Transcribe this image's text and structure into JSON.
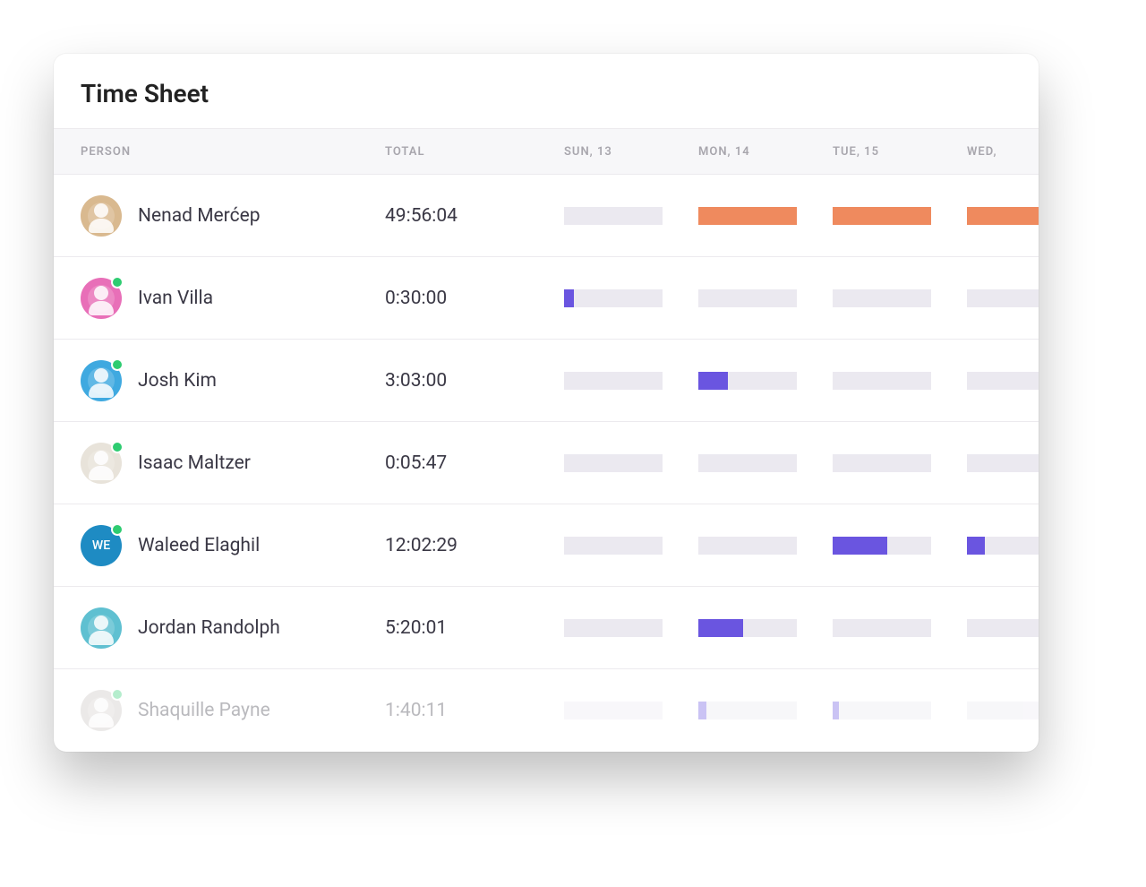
{
  "title": "Time Sheet",
  "columns": {
    "person": "PERSON",
    "total": "TOTAL",
    "days": [
      "SUN, 13",
      "MON, 14",
      "TUE, 15",
      "WED,"
    ]
  },
  "colors": {
    "bar_track": "#ebe9f0",
    "bar_purple": "#6a55e0",
    "bar_orange": "#ef8a5e",
    "status_online": "#2ecc71"
  },
  "people": [
    {
      "name": "Nenad Merćep",
      "total": "49:56:04",
      "online": false,
      "avatar": {
        "type": "photo",
        "bg": "#d9b98f"
      },
      "bars": [
        {
          "fill": 0,
          "color": "purple"
        },
        {
          "fill": 100,
          "color": "orange"
        },
        {
          "fill": 100,
          "color": "orange"
        },
        {
          "fill": 100,
          "color": "orange"
        }
      ]
    },
    {
      "name": "Ivan Villa",
      "total": "0:30:00",
      "online": true,
      "avatar": {
        "type": "photo",
        "bg": "#e86fb8"
      },
      "bars": [
        {
          "fill": 10,
          "color": "purple"
        },
        {
          "fill": 0,
          "color": "purple"
        },
        {
          "fill": 0,
          "color": "purple"
        },
        {
          "fill": 0,
          "color": "purple"
        }
      ]
    },
    {
      "name": "Josh Kim",
      "total": "3:03:00",
      "online": true,
      "avatar": {
        "type": "photo",
        "bg": "#3fa9e0"
      },
      "bars": [
        {
          "fill": 0,
          "color": "purple"
        },
        {
          "fill": 30,
          "color": "purple"
        },
        {
          "fill": 0,
          "color": "purple"
        },
        {
          "fill": 0,
          "color": "purple"
        }
      ]
    },
    {
      "name": "Isaac Maltzer",
      "total": "0:05:47",
      "online": true,
      "avatar": {
        "type": "photo",
        "bg": "#e8e3da"
      },
      "bars": [
        {
          "fill": 0,
          "color": "purple"
        },
        {
          "fill": 0,
          "color": "purple"
        },
        {
          "fill": 0,
          "color": "purple"
        },
        {
          "fill": 0,
          "color": "purple"
        }
      ]
    },
    {
      "name": "Waleed Elaghil",
      "total": "12:02:29",
      "online": true,
      "avatar": {
        "type": "initials",
        "initials": "WE",
        "bg": "#1e8bc3"
      },
      "bars": [
        {
          "fill": 0,
          "color": "purple"
        },
        {
          "fill": 0,
          "color": "purple"
        },
        {
          "fill": 55,
          "color": "purple"
        },
        {
          "fill": 18,
          "color": "purple"
        }
      ]
    },
    {
      "name": "Jordan Randolph",
      "total": "5:20:01",
      "online": false,
      "avatar": {
        "type": "photo",
        "bg": "#5fc0d1"
      },
      "bars": [
        {
          "fill": 0,
          "color": "purple"
        },
        {
          "fill": 45,
          "color": "purple"
        },
        {
          "fill": 0,
          "color": "purple"
        },
        {
          "fill": 0,
          "color": "purple"
        }
      ]
    },
    {
      "name": "Shaquille Payne",
      "total": "1:40:11",
      "online": true,
      "faded": true,
      "avatar": {
        "type": "photo",
        "bg": "#c8c3c0"
      },
      "bars": [
        {
          "fill": 0,
          "color": "purple"
        },
        {
          "fill": 8,
          "color": "purple"
        },
        {
          "fill": 6,
          "color": "purple"
        },
        {
          "fill": 0,
          "color": "purple"
        }
      ]
    }
  ]
}
